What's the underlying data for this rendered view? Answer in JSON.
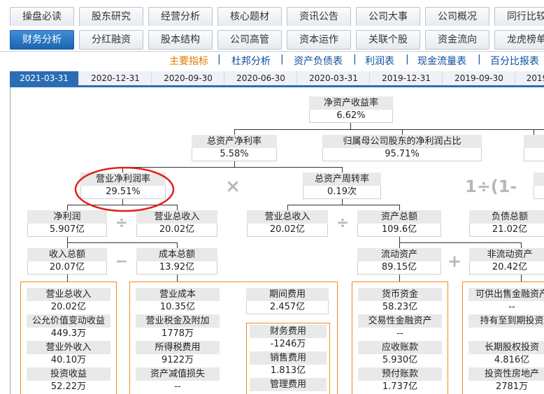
{
  "nav_row1": [
    "操盘必读",
    "股东研究",
    "经营分析",
    "核心题材",
    "资讯公告",
    "公司大事",
    "公司概况",
    "同行比较"
  ],
  "nav_row2": [
    "财务分析",
    "分红融资",
    "股本结构",
    "公司高管",
    "资本运作",
    "关联个股",
    "资金流向",
    "龙虎榜单"
  ],
  "sub_links": [
    "主要指标",
    "杜邦分析",
    "资产负债表",
    "利润表",
    "现金流量表",
    "百分比报表"
  ],
  "sub_sep": "|",
  "dates": [
    "2021-03-31",
    "2020-12-31",
    "2020-09-30",
    "2020-06-30",
    "2020-03-31",
    "2019-12-31",
    "2019-09-30",
    "2019"
  ],
  "tree": {
    "roe": {
      "title": "净资产收益率",
      "value": "6.62%"
    },
    "roa": {
      "title": "总资产净利率",
      "value": "5.58%"
    },
    "parent_share": {
      "title": "归属母公司股东的净利润占比",
      "value": "95.71%"
    },
    "net_margin": {
      "title": "营业净利润率",
      "value": "29.51%"
    },
    "turnover": {
      "title": "总资产周转率",
      "value": "0.19次"
    },
    "net_profit": {
      "title": "净利润",
      "value": "5.907亿"
    },
    "revenue1": {
      "title": "营业总收入",
      "value": "20.02亿"
    },
    "revenue2": {
      "title": "营业总收入",
      "value": "20.02亿"
    },
    "total_assets": {
      "title": "资产总额",
      "value": "109.6亿"
    },
    "total_liab": {
      "title": "负债总额",
      "value": "21.02亿"
    },
    "income_total": {
      "title": "收入总额",
      "value": "20.07亿"
    },
    "cost_total": {
      "title": "成本总额",
      "value": "13.92亿"
    },
    "current_assets": {
      "title": "流动资产",
      "value": "89.15亿"
    },
    "noncurrent_assets": {
      "title": "非流动资产",
      "value": "20.42亿"
    },
    "period_exp": {
      "title": "期间费用",
      "value": "2.457亿"
    },
    "ops": {
      "times": "×",
      "divide": "÷",
      "minus": "−",
      "plus": "+",
      "formula": "1÷(1-"
    }
  },
  "income_items": [
    {
      "title": "营业总收入",
      "value": "20.02亿"
    },
    {
      "title": "公允价值变动收益",
      "value": "449.3万"
    },
    {
      "title": "营业外收入",
      "value": "40.10万"
    },
    {
      "title": "投资收益",
      "value": "52.22万"
    }
  ],
  "cost_items": [
    {
      "title": "营业成本",
      "value": "10.35亿"
    },
    {
      "title": "营业税金及附加",
      "value": "1778万"
    },
    {
      "title": "所得税费用",
      "value": "9122万"
    },
    {
      "title": "资产减值损失",
      "value": "--"
    }
  ],
  "exp_items": [
    {
      "title": "财务费用",
      "value": "-1246万"
    },
    {
      "title": "销售费用",
      "value": "1.813亿"
    },
    {
      "title": "管理费用",
      "value": ""
    }
  ],
  "current_items": [
    {
      "title": "货币资金",
      "value": "58.23亿"
    },
    {
      "title": "交易性金融资产",
      "value": "--"
    },
    {
      "title": "应收账款",
      "value": "5.930亿"
    },
    {
      "title": "预付账款",
      "value": "1.737亿"
    }
  ],
  "noncurrent_items": [
    {
      "title": "可供出售金融资产",
      "value": "--"
    },
    {
      "title": "持有至到期投资",
      "value": ""
    },
    {
      "title": "长期股权投资",
      "value": "4.816亿"
    },
    {
      "title": "投资性房地产",
      "value": "2781万"
    }
  ],
  "colors": {
    "active_tab": "#1b63b0",
    "orange": "#f08a1c",
    "highlight_ring": "#e0201a",
    "link": "#0b4fa0"
  }
}
